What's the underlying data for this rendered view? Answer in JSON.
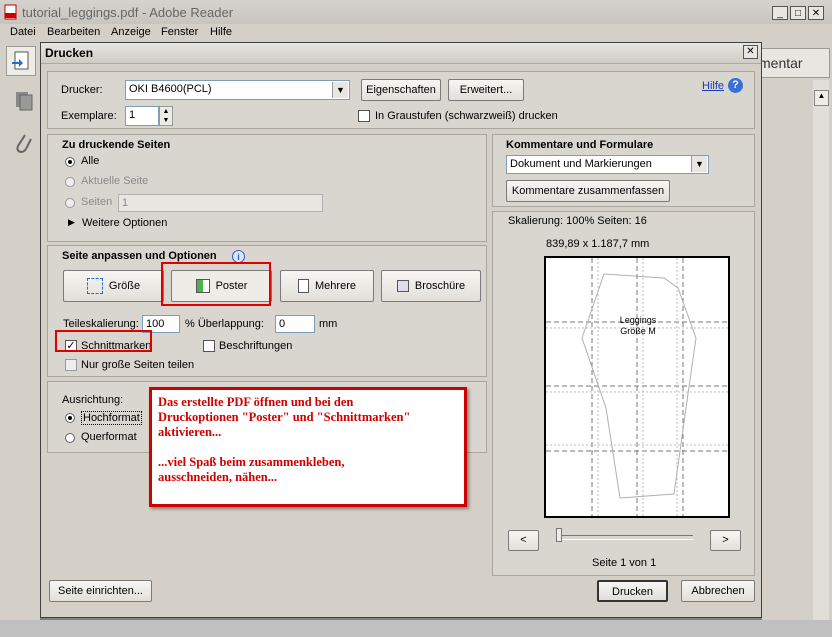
{
  "app": {
    "title": "tutorial_leggings.pdf - Adobe Reader",
    "menu": [
      "Datei",
      "Bearbeiten",
      "Anzeige",
      "Fenster",
      "Hilfe"
    ],
    "kommentar_label": "mentar"
  },
  "dialog": {
    "title": "Drucken",
    "printer_label": "Drucker:",
    "printer_value": "OKI B4600(PCL)",
    "properties_button": "Eigenschaften",
    "advanced_button": "Erweitert...",
    "help_link": "Hilfe",
    "copies_label": "Exemplare:",
    "copies_value": "1",
    "grayscale_label": "In Graustufen (schwarzweiß) drucken",
    "pages": {
      "heading": "Zu druckende Seiten",
      "all": "Alle",
      "current": "Aktuelle Seite",
      "pages_label": "Seiten",
      "pages_value": "1",
      "more_options": "Weitere Optionen"
    },
    "fit": {
      "heading": "Seite anpassen und Optionen",
      "size_button": "Größe",
      "poster_button": "Poster",
      "multiple_button": "Mehrere",
      "booklet_button": "Broschüre",
      "tile_scale_label": "Teileskalierung:",
      "tile_scale_value": "100",
      "overlap_label": "% Überlappung:",
      "overlap_value": "0",
      "overlap_unit": "mm",
      "cut_marks": "Schnittmarken",
      "labels": "Beschriftungen",
      "large_pages": "Nur große Seiten teilen"
    },
    "orientation": {
      "heading": "Ausrichtung:",
      "portrait": "Hochformat",
      "landscape": "Querformat"
    },
    "comments": {
      "heading": "Kommentare und Formulare",
      "value": "Dokument und Markierungen",
      "summarize_button": "Kommentare zusammenfassen"
    },
    "preview": {
      "scale_text": "Skalierung: 100% Seiten: 16",
      "dimensions": "839,89 x 1.187,7 mm",
      "page_label_1": "Leggings",
      "page_label_2": "Größe M",
      "prev": "<",
      "next": ">",
      "page_counter": "Seite 1 von 1"
    },
    "page_setup_button": "Seite einrichten...",
    "print_button": "Drucken",
    "cancel_button": "Abbrechen"
  },
  "annotation": {
    "line1": "Das erstellte PDF öffnen und bei den",
    "line2": "Druckoptionen \"Poster\" und \"Schnittmarken\"",
    "line3": "aktivieren...",
    "line4": "...viel Spaß beim zusammenkleben,",
    "line5": "ausschneiden, nähen..."
  }
}
